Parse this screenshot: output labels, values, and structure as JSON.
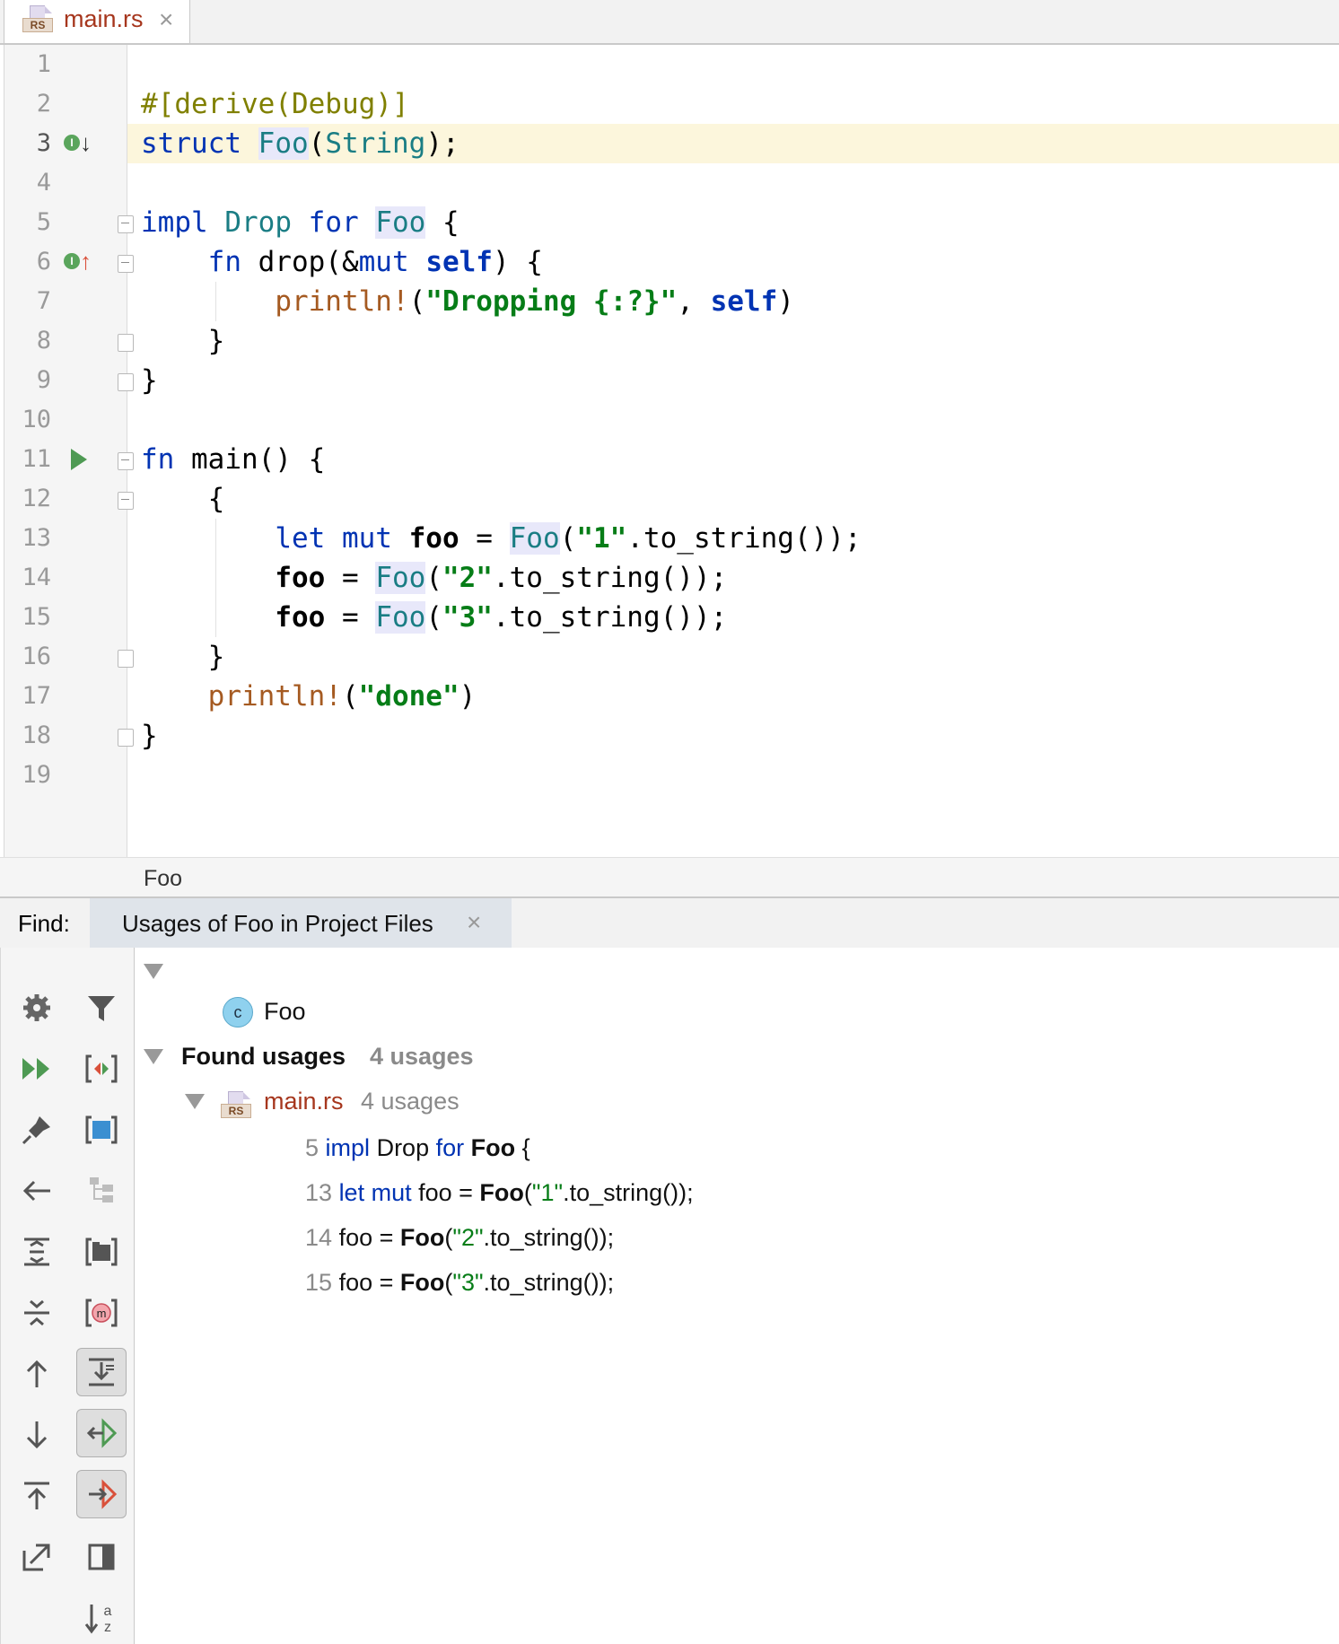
{
  "tab": {
    "title": "main.rs",
    "close": "×",
    "icon_label": "RS"
  },
  "editor": {
    "line_numbers": [
      "1",
      "2",
      "3",
      "4",
      "5",
      "6",
      "7",
      "8",
      "9",
      "10",
      "11",
      "12",
      "13",
      "14",
      "15",
      "16",
      "17",
      "18",
      "19"
    ],
    "current_line": 3,
    "code": {
      "l2_attr": "#[derive(Debug)]",
      "l3_struct": "struct",
      "l3_foo": "Foo",
      "l3_paren_open": "(",
      "l3_string": "String",
      "l3_end": ");",
      "l5_impl": "impl",
      "l5_drop": "Drop",
      "l5_for": "for",
      "l5_foo": "Foo",
      "l5_brace": " {",
      "l6_fn": "fn",
      "l6_rest": " drop(&",
      "l6_mut": "mut",
      "l6_self": "self",
      "l6_end": ") {",
      "l7_macro": "println!",
      "l7_paren": "(",
      "l7_str": "\"Dropping {:?}\"",
      "l7_comma": ", ",
      "l7_self": "self",
      "l7_end": ")",
      "l8_brace": "}",
      "l9_brace": "}",
      "l11_fn": "fn",
      "l11_rest": " main() {",
      "l12_brace": "{",
      "l13_let": "let mut",
      "l13_var": "foo",
      "l13_eq": " = ",
      "l13_foo": "Foo",
      "l13_open": "(",
      "l13_str": "\"1\"",
      "l13_rest": ".to_string());",
      "l14_var": "foo",
      "l14_eq": " = ",
      "l14_foo": "Foo",
      "l14_open": "(",
      "l14_str": "\"2\"",
      "l14_rest": ".to_string());",
      "l15_var": "foo",
      "l15_eq": " = ",
      "l15_foo": "Foo",
      "l15_open": "(",
      "l15_str": "\"3\"",
      "l15_rest": ".to_string());",
      "l16_brace": "}",
      "l17_macro": "println!",
      "l17_paren": "(",
      "l17_str": "\"done\"",
      "l17_end": ")",
      "l18_brace": "}"
    },
    "gutter_icons": {
      "implemented_marker": "I",
      "implementing_marker": "I"
    }
  },
  "breadcrumb": "Foo",
  "find": {
    "label": "Find:",
    "tab_title": "Usages of Foo in Project Files",
    "tab_close": "×",
    "target": {
      "icon_letter": "c",
      "name": "Foo"
    },
    "found": {
      "label": "Found usages",
      "count": "4 usages"
    },
    "file": {
      "name": "main.rs",
      "count": "4 usages",
      "icon_label": "RS"
    },
    "usages": [
      {
        "line": "5",
        "pre_kw": "impl",
        "mid": " Drop ",
        "kw2": "for",
        "sym": "Foo",
        "post": " {"
      },
      {
        "line": "13",
        "pre_kw": "let mut",
        "mid": " foo = ",
        "sym": "Foo",
        "open": "(",
        "str": "\"1\"",
        "post": ".to_string());"
      },
      {
        "line": "14",
        "mid": "foo = ",
        "sym": "Foo",
        "open": "(",
        "str": "\"2\"",
        "post": ".to_string());"
      },
      {
        "line": "15",
        "mid": "foo = ",
        "sym": "Foo",
        "open": "(",
        "str": "\"3\"",
        "post": ".to_string());"
      }
    ],
    "sort_label_top": "a",
    "sort_label_bottom": "z"
  },
  "colors": {
    "keyword": "#0033b3",
    "type": "#1a7d84",
    "macro": "#a55a21",
    "string": "#067d17",
    "attribute": "#808000",
    "current_line": "#fcf6dc",
    "file_name": "#a6361d"
  },
  "icons": {
    "tab": "rust-file-icon",
    "toolbar": [
      "gear-icon",
      "filter-icon",
      "rerun-icon",
      "preview-icon",
      "pin-icon",
      "expand-selection-icon",
      "back-icon",
      "group-icon",
      "expand-all-icon",
      "module-group-icon",
      "collapse-all-icon",
      "method-group-icon",
      "prev-occurrence-icon",
      "merge-lines-icon",
      "next-occurrence-icon",
      "navigate-green-icon",
      "export-icon",
      "navigate-red-icon",
      "open-in-window-icon",
      "toggle-panel-icon",
      "sort-alpha-icon"
    ]
  }
}
